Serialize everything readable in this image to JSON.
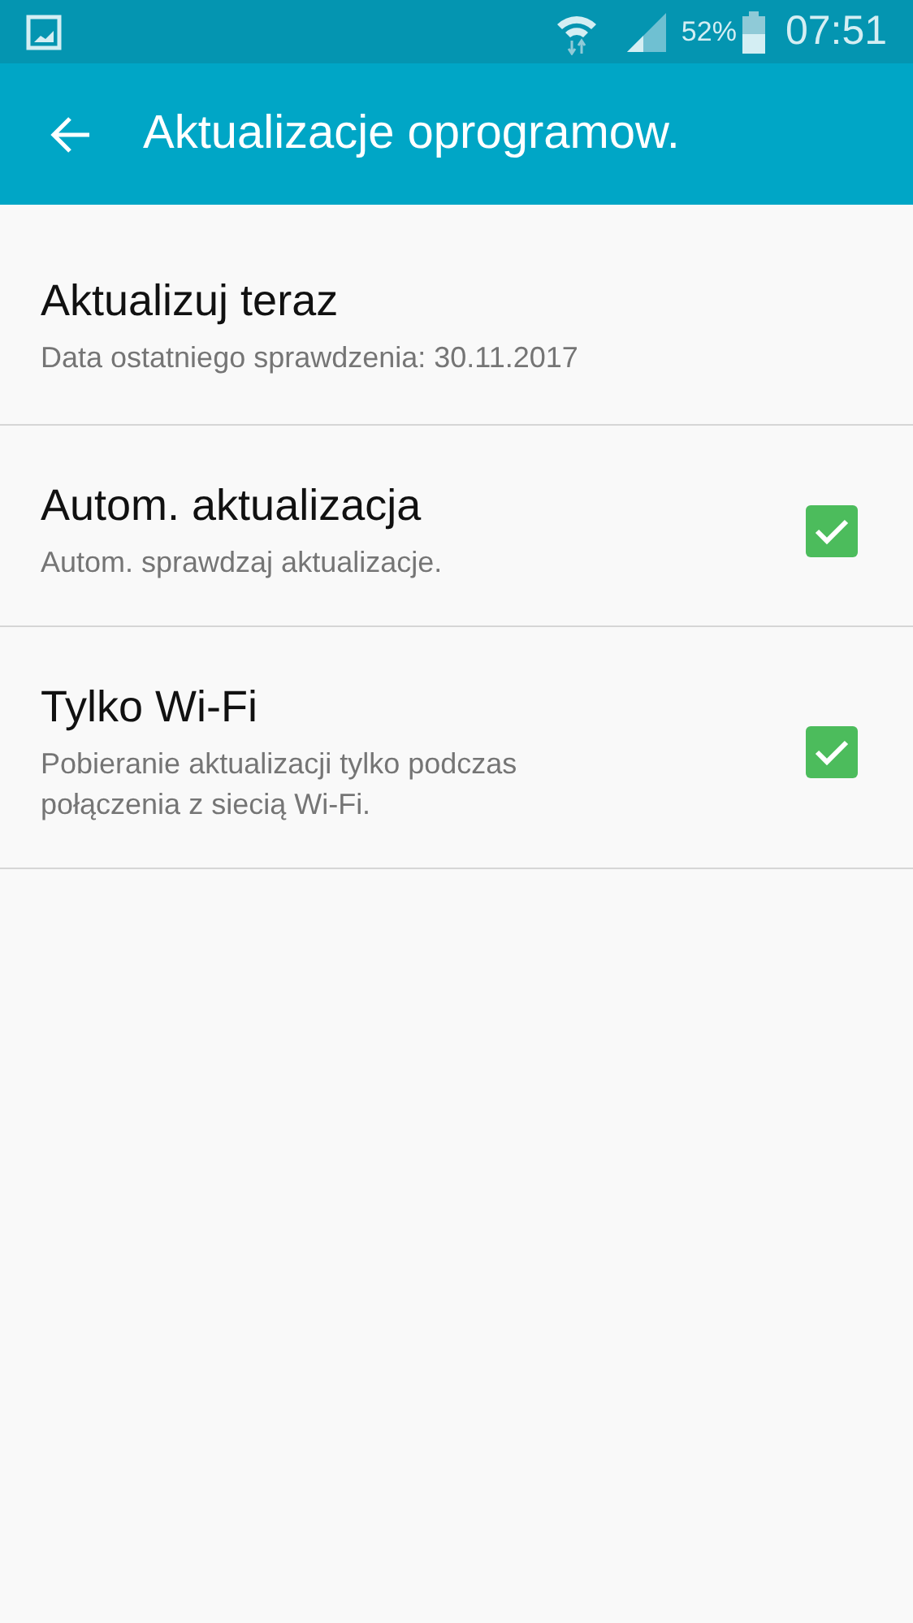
{
  "status_bar": {
    "battery": "52%",
    "time": "07:51"
  },
  "toolbar": {
    "title": "Aktualizacje oprogramow."
  },
  "items": [
    {
      "kind": "action",
      "title": "Aktualizuj teraz",
      "summary": "Data ostatniego sprawdzenia: 30.11.2017"
    },
    {
      "kind": "toggle",
      "title": "Autom. aktualizacja",
      "summary": "Autom. sprawdzaj aktualizacje.",
      "checked": true
    },
    {
      "kind": "toggle",
      "title": "Tylko Wi-Fi",
      "summary": "Pobieranie aktualizacji tylko podczas połączenia z siecią Wi-Fi.",
      "checked": true
    }
  ]
}
